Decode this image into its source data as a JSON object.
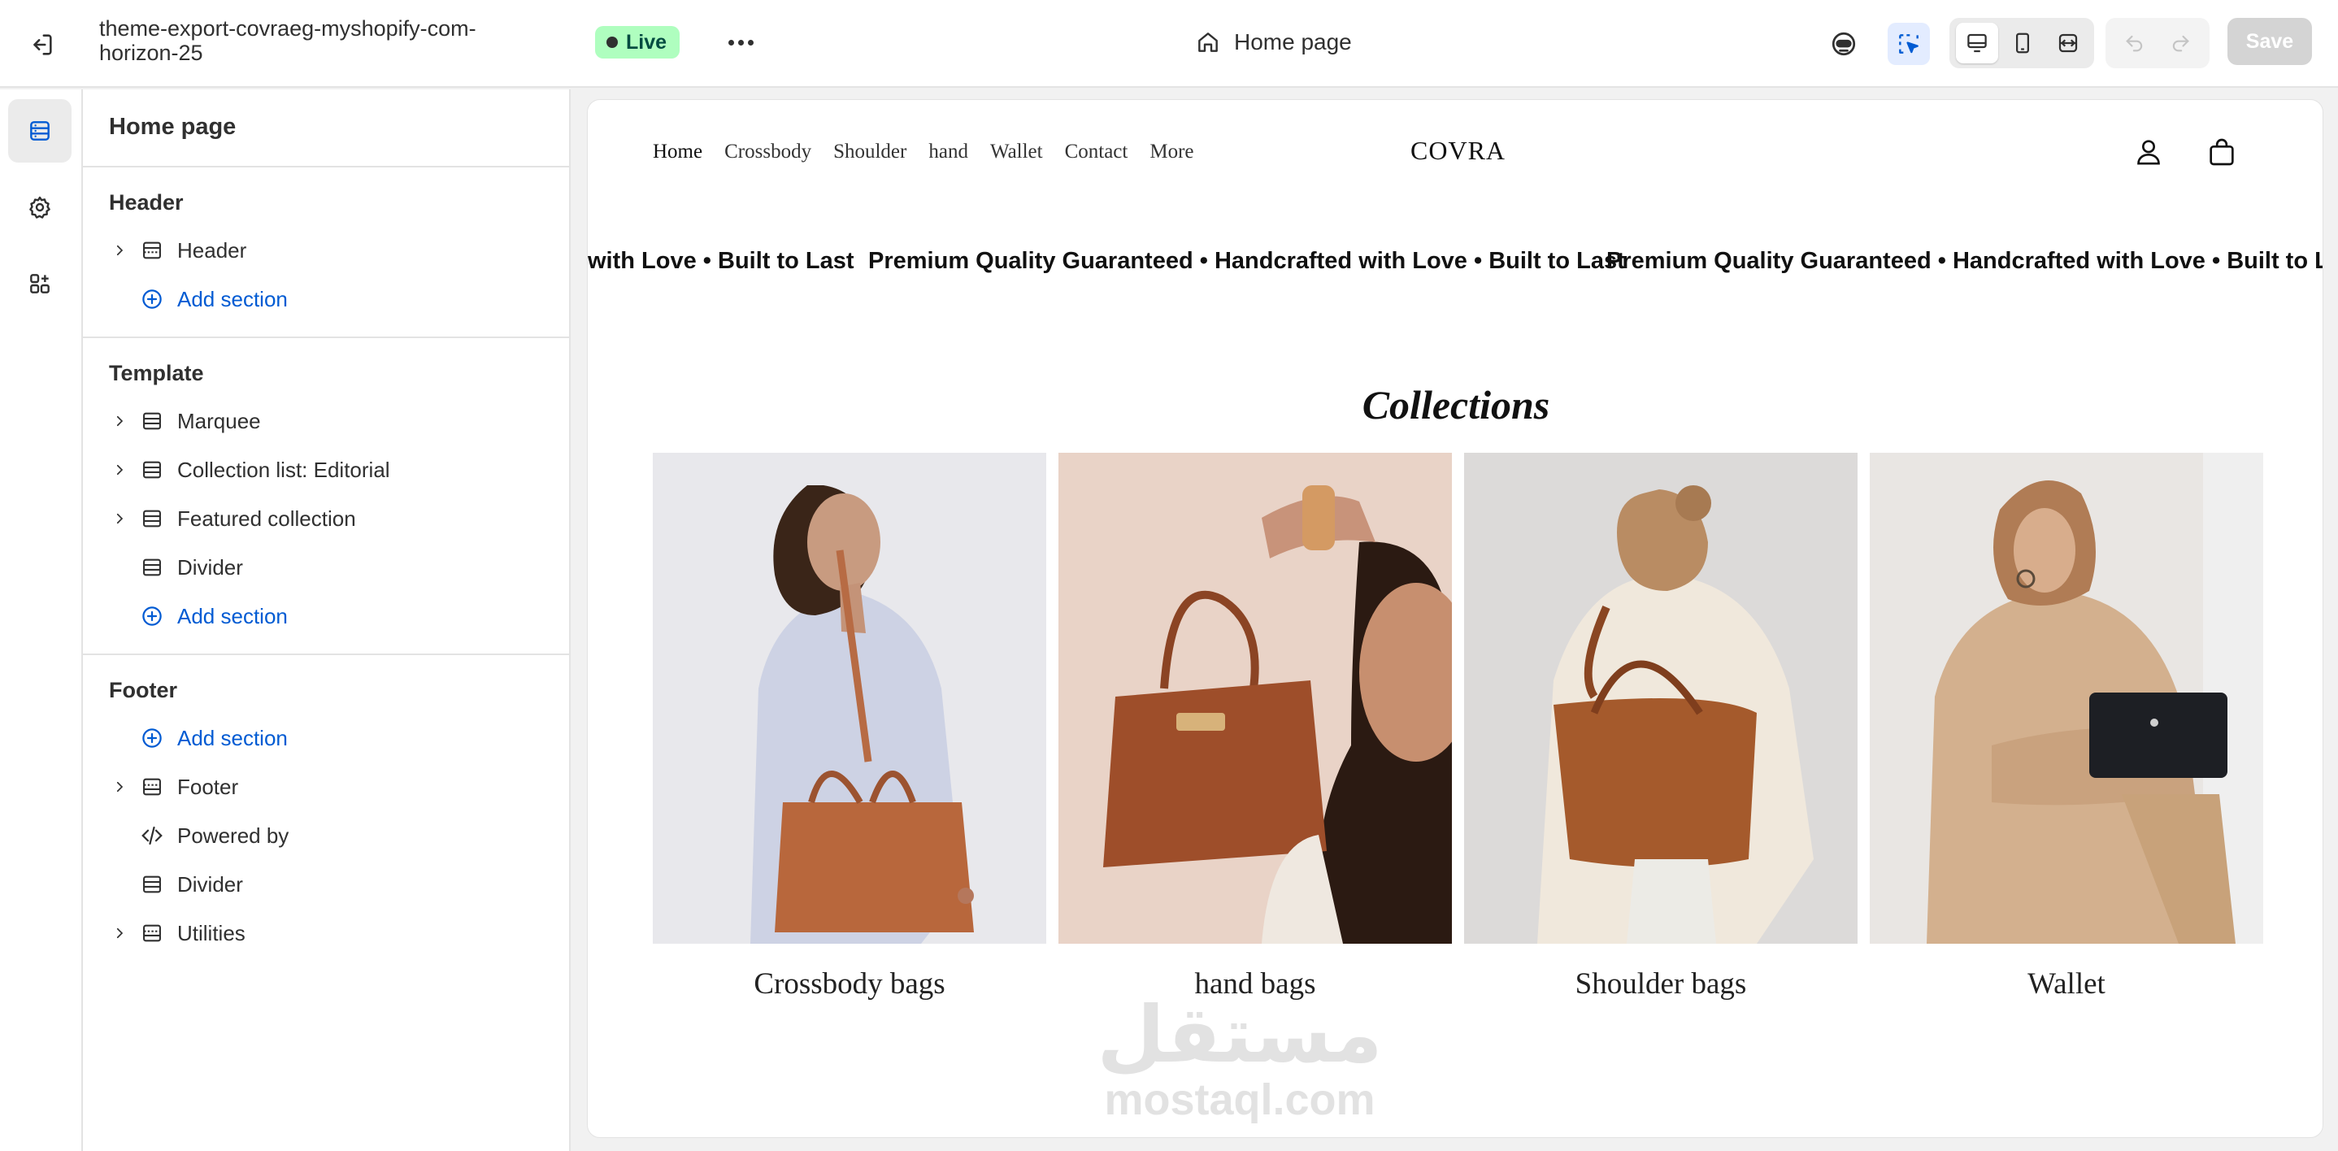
{
  "topbar": {
    "store_name": "theme-export-covraeg-myshopify-com-horizon-25",
    "status_badge": "Live",
    "current_page": "Home page",
    "save_label": "Save"
  },
  "panel": {
    "title": "Home page",
    "groups": [
      {
        "title": "Header",
        "items": [
          {
            "label": "Header",
            "expandable": true,
            "icon": "header-section-icon"
          }
        ],
        "add_label": "Add section"
      },
      {
        "title": "Template",
        "items": [
          {
            "label": "Marquee",
            "expandable": true,
            "icon": "section-icon"
          },
          {
            "label": "Collection list: Editorial",
            "expandable": true,
            "icon": "section-icon"
          },
          {
            "label": "Featured collection",
            "expandable": true,
            "icon": "section-icon"
          },
          {
            "label": "Divider",
            "expandable": false,
            "icon": "section-icon"
          }
        ],
        "add_label": "Add section"
      },
      {
        "title": "Footer",
        "add_label": "Add section",
        "items": [
          {
            "label": "Footer",
            "expandable": true,
            "icon": "footer-section-icon"
          },
          {
            "label": "Powered by",
            "expandable": false,
            "icon": "code-icon"
          },
          {
            "label": "Divider",
            "expandable": false,
            "icon": "section-icon"
          },
          {
            "label": "Utilities",
            "expandable": true,
            "icon": "footer-section-icon"
          }
        ]
      }
    ]
  },
  "store": {
    "nav": [
      "Home",
      "Crossbody",
      "Shoulder",
      "hand",
      "Wallet",
      "Contact",
      "More"
    ],
    "logo": "COVRA",
    "marquee": [
      "with Love • Built to Last",
      "Premium Quality Guaranteed • Handcrafted with Love • Built to Last",
      "Premium Quality Guaranteed • Handcrafted with Love • Built to Last"
    ],
    "collections_heading": "Collections",
    "collections": [
      {
        "label": "Crossbody bags"
      },
      {
        "label": "hand bags"
      },
      {
        "label": "Shoulder bags"
      },
      {
        "label": "Wallet"
      }
    ]
  },
  "watermark": {
    "arabic": "مستقل",
    "latin": "mostaql.com"
  },
  "colors": {
    "accent": "#005bd3",
    "live_badge": "#affebf",
    "save_disabled": "#d4d4d4",
    "bag_leather": "#a55a32"
  }
}
